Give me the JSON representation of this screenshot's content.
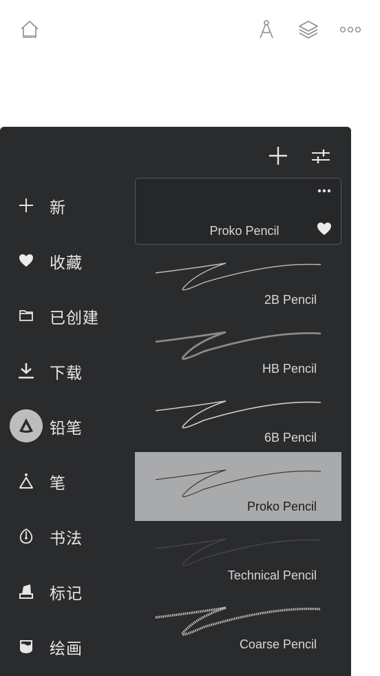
{
  "topbar": {
    "icons": [
      "home-icon",
      "compass-icon",
      "layers-icon",
      "more-icon"
    ]
  },
  "panel": {
    "toolbar": {
      "add_icon": "plus-icon",
      "settings_icon": "sliders-icon"
    },
    "categories": [
      {
        "label": "新",
        "icon": "plus-icon"
      },
      {
        "label": "收藏",
        "icon": "heart-icon"
      },
      {
        "label": "已创建",
        "icon": "folder-icon"
      },
      {
        "label": "下载",
        "icon": "download-icon"
      },
      {
        "label": "铅笔",
        "icon": "pencil-tip-icon",
        "active": true
      },
      {
        "label": "笔",
        "icon": "pen-nib-icon"
      },
      {
        "label": "书法",
        "icon": "calligraphy-nib-icon"
      },
      {
        "label": "标记",
        "icon": "marker-icon"
      },
      {
        "label": "绘画",
        "icon": "paint-pot-icon"
      }
    ],
    "brushes": [
      {
        "name": "Proko Pencil",
        "state": "selected"
      },
      {
        "name": "2B Pencil"
      },
      {
        "name": "HB Pencil"
      },
      {
        "name": "6B Pencil"
      },
      {
        "name": "Proko Pencil",
        "state": "highlighted"
      },
      {
        "name": "Technical Pencil"
      },
      {
        "name": "Coarse Pencil"
      }
    ]
  },
  "colors": {
    "panel_bg": "#2a2b2d",
    "highlight_bg": "#a9aaac",
    "active_icon_bg": "#bdbdbd",
    "text": "#e6e6e6"
  }
}
